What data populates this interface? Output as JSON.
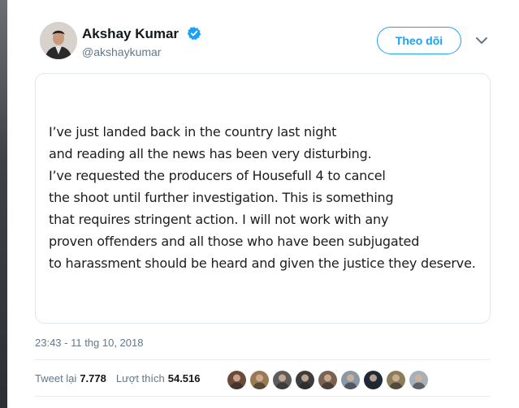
{
  "user": {
    "name": "Akshay Kumar",
    "handle": "@akshaykumar",
    "verified_icon": "verified-badge-icon",
    "follow_label": "Theo dõi"
  },
  "tweet": {
    "image_text_lines": [
      "I’ve just landed back in the country last night",
      "and reading all the news has been very disturbing.",
      "I’ve requested the producers of Housefull 4 to cancel",
      "the shoot until further investigation. This is something",
      "that requires stringent action. I will not work with any",
      "proven offenders and all those who have been subjugated",
      "to harassment should be heard and given the justice they deserve."
    ],
    "timestamp": "23:43 - 11 thg 10, 2018"
  },
  "stats": {
    "retweets_label": "Tweet lại",
    "retweets_count": "7.778",
    "likes_label": "Lượt thích",
    "likes_count": "54.516"
  },
  "colors": {
    "accent": "#1da1f2",
    "secondary_text": "#657786",
    "primary_text": "#14171a",
    "border": "#e1e8ed"
  },
  "likers": [
    {
      "color": "#6b4a3a"
    },
    {
      "color": "#9a7a55"
    },
    {
      "color": "#5c5c5c"
    },
    {
      "color": "#3d3d3d"
    },
    {
      "color": "#7a6250"
    },
    {
      "color": "#8a98a6"
    },
    {
      "color": "#1e2a38"
    },
    {
      "color": "#8b7d5a"
    },
    {
      "color": "#a7b0b8"
    }
  ]
}
